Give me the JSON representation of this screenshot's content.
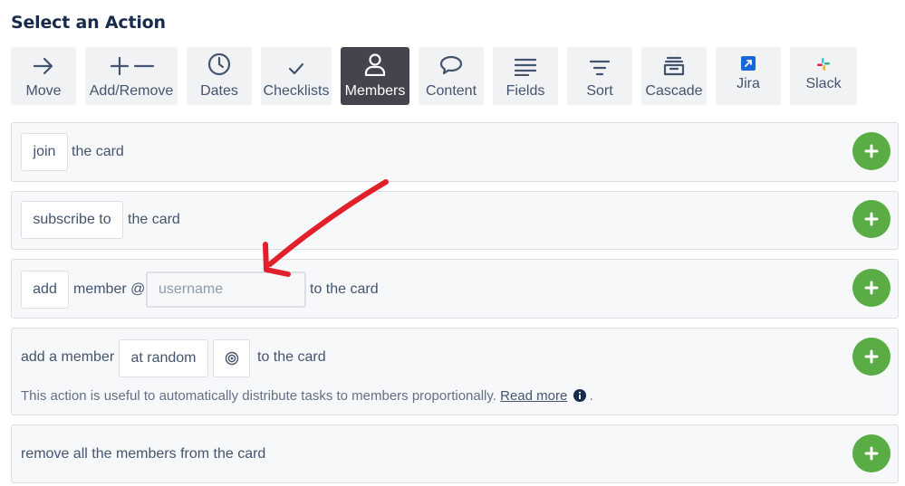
{
  "heading": "Select an Action",
  "toolbar": {
    "move": "Move",
    "add_remove": "Add/Remove",
    "dates": "Dates",
    "checklists": "Checklists",
    "members": "Members",
    "content": "Content",
    "fields": "Fields",
    "sort": "Sort",
    "cascade": "Cascade",
    "jira": "Jira",
    "slack": "Slack",
    "active_tab": "Members"
  },
  "actions": {
    "join": {
      "verb": "join",
      "suffix": "the card"
    },
    "subscribe": {
      "verb": "subscribe to",
      "suffix": "the card"
    },
    "add": {
      "verb": "add",
      "middle": "member @",
      "placeholder": "username",
      "suffix": "to the card"
    },
    "random": {
      "prefix": "add a member",
      "mode": "at random",
      "suffix": "to the card",
      "note": "This action is useful to automatically distribute tasks to members proportionally.",
      "read_more": "Read more",
      "period": "."
    },
    "remove_all": {
      "text": "remove all the members from the card"
    }
  },
  "colors": {
    "add_button": "#5aac44",
    "active_tab": "#44444f",
    "annotation_arrow": "#e0202a"
  }
}
